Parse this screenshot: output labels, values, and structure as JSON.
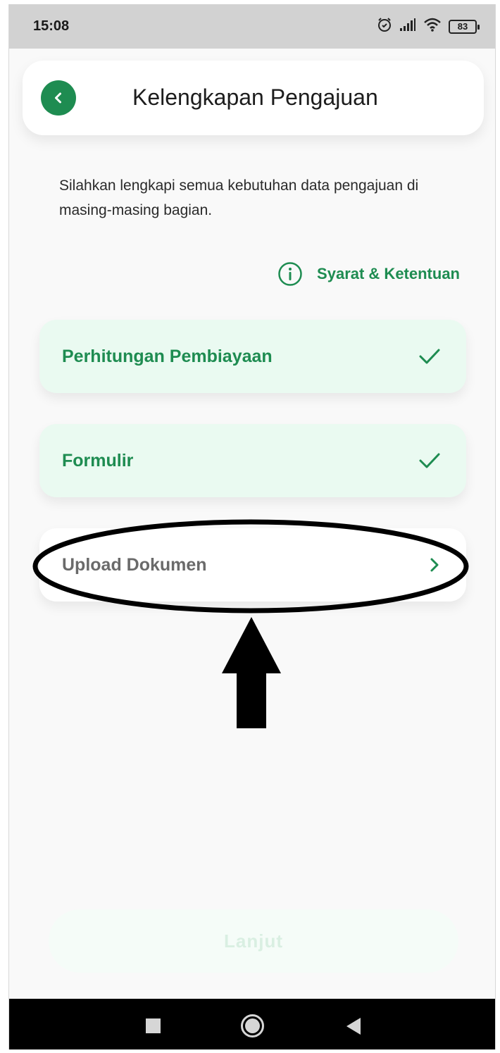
{
  "status_bar": {
    "time": "15:08",
    "battery": "83",
    "icons": [
      "alarm-icon",
      "signal-icon",
      "wifi-icon",
      "battery-icon"
    ]
  },
  "header": {
    "title": "Kelengkapan Pengajuan",
    "back_icon": "chevron-left-icon"
  },
  "intro_text": "Silahkan lengkapi semua kebutuhan data pengajuan di masing-masing bagian.",
  "terms": {
    "label": "Syarat & Ketentuan",
    "icon": "info-icon"
  },
  "sections": [
    {
      "label": "Perhitungan Pembiayaan",
      "status": "complete",
      "icon": "check-icon"
    },
    {
      "label": "Formulir",
      "status": "complete",
      "icon": "check-icon"
    },
    {
      "label": "Upload Dokumen",
      "status": "incomplete",
      "icon": "chevron-right-icon"
    }
  ],
  "primary_button": {
    "label": "Lanjut",
    "state": "disabled"
  },
  "colors": {
    "accent": "#1e8c51",
    "done_card": "#eafaf1",
    "statusbar": "#d2d2d2",
    "disabled_button": "#f5fcf8"
  },
  "nav_bar": {
    "icons": [
      "recents-icon",
      "home-icon",
      "back-icon"
    ]
  }
}
